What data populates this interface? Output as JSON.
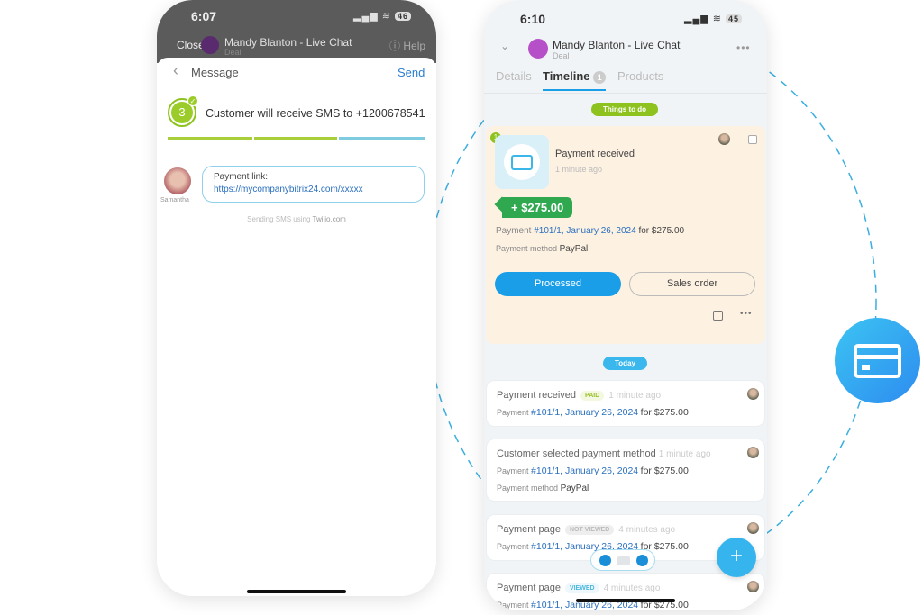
{
  "left_phone": {
    "status": {
      "time": "6:07",
      "battery": "46"
    },
    "header": {
      "close": "Close",
      "title": "Mandy Blanton - Live Chat",
      "subtitle": "Deal",
      "help": "Help"
    },
    "sheet": {
      "back": "Message",
      "send": "Send",
      "step": "3",
      "step_text": "Customer will receive SMS to +1200678541",
      "progress_colors": [
        "#a8cf3a",
        "#a8cf3a",
        "#7fcbe0"
      ],
      "avatar_name": "Samantha",
      "msg_label": "Payment link:",
      "msg_link": "https://mycompanybitrix24.com/xxxxx",
      "sending_prefix": "Sending SMS using",
      "sending_provider": "Twilio.com"
    }
  },
  "right_phone": {
    "status": {
      "time": "6:10",
      "battery": "45"
    },
    "header": {
      "title": "Mandy Blanton - Live Chat",
      "subtitle": "Deal"
    },
    "tabs": [
      {
        "label": "Details"
      },
      {
        "label": "Timeline",
        "count": "1",
        "active": true
      },
      {
        "label": "Products"
      }
    ],
    "todo_label": "Things to do",
    "todo": {
      "counter": "1",
      "title": "Payment received",
      "time": "1 minute ago",
      "amount": "+ $275.00",
      "pay_prefix": "Payment",
      "pay_link": "#101/1, January 26, 2024",
      "pay_suffix": "for $275.00",
      "method_label": "Payment method",
      "method": "PayPal",
      "btn_processed": "Processed",
      "btn_sales": "Sales order"
    },
    "today_label": "Today",
    "items": [
      {
        "title": "Payment received",
        "badge": "PAID",
        "time": "1 minute ago",
        "pay_prefix": "Payment",
        "pay_link": "#101/1, January 26, 2024",
        "pay_suffix": "for $275.00"
      },
      {
        "title": "Customer selected payment method",
        "time": "1 minute ago",
        "pay_prefix": "Payment",
        "pay_link": "#101/1, January 26, 2024",
        "pay_suffix": "for $275.00",
        "method_label": "Payment method",
        "method": "PayPal"
      },
      {
        "title": "Payment page",
        "badge": "NOT VIEWED",
        "time": "4 minutes ago",
        "pay_prefix": "Payment",
        "pay_link": "#101/1, January 26, 2024",
        "pay_suffix": "for $275.00"
      },
      {
        "title": "Payment page",
        "badge": "VIEWED",
        "time": "4 minutes ago",
        "pay_prefix": "Payment",
        "pay_link": "#101/1, January 26, 2024",
        "pay_suffix": "for $275.00"
      }
    ],
    "fab": "+"
  },
  "colors": {
    "accent": "#1a9ee8",
    "green": "#8dc21f",
    "todo_bg": "#fdf1e2",
    "amount_green": "#2fa84f"
  }
}
